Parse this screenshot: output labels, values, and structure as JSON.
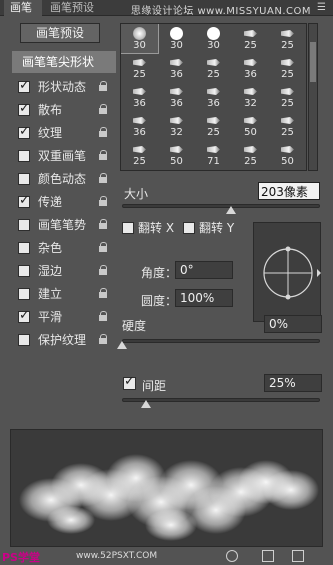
{
  "tabs": [
    {
      "label": "画笔"
    },
    {
      "label": "画笔预设"
    }
  ],
  "watermark": "思缘设计论坛 www.MISSYUAN.COM",
  "preset_button": "画笔预设",
  "sidebar": {
    "header": "画笔笔尖形状",
    "items": [
      {
        "label": "形状动态",
        "checked": true
      },
      {
        "label": "散布",
        "checked": true
      },
      {
        "label": "纹理",
        "checked": true
      },
      {
        "label": "双重画笔",
        "checked": false
      },
      {
        "label": "颜色动态",
        "checked": false
      },
      {
        "label": "传递",
        "checked": true
      },
      {
        "label": "画笔笔势",
        "checked": false
      },
      {
        "label": "杂色",
        "checked": false
      },
      {
        "label": "湿边",
        "checked": false
      },
      {
        "label": "建立",
        "checked": false
      },
      {
        "label": "平滑",
        "checked": true
      },
      {
        "label": "保护纹理",
        "checked": false
      }
    ]
  },
  "brush_grid": {
    "sizes": [
      "30",
      "30",
      "30",
      "25",
      "25",
      "25",
      "36",
      "25",
      "36",
      "25",
      "36",
      "36",
      "36",
      "32",
      "25",
      "36",
      "32",
      "25",
      "50",
      "25",
      "25",
      "50",
      "71",
      "25",
      "50",
      "25",
      "50",
      "50",
      "36",
      "25"
    ]
  },
  "size": {
    "label": "大小",
    "value": "203像素",
    "slider_fraction": 0.55
  },
  "flip": {
    "x_label": "翻转 X",
    "y_label": "翻转 Y"
  },
  "angle": {
    "label": "角度：",
    "value": "0°"
  },
  "roundness": {
    "label": "圆度：",
    "value": "100%"
  },
  "hardness": {
    "label": "硬度",
    "value": "0%",
    "slider_fraction": 0.0
  },
  "spacing": {
    "label": "间距",
    "value": "25%",
    "checked": true,
    "slider_fraction": 0.12
  },
  "footer": {
    "logo": "PS学堂",
    "site": "www.52PSXT.COM"
  }
}
